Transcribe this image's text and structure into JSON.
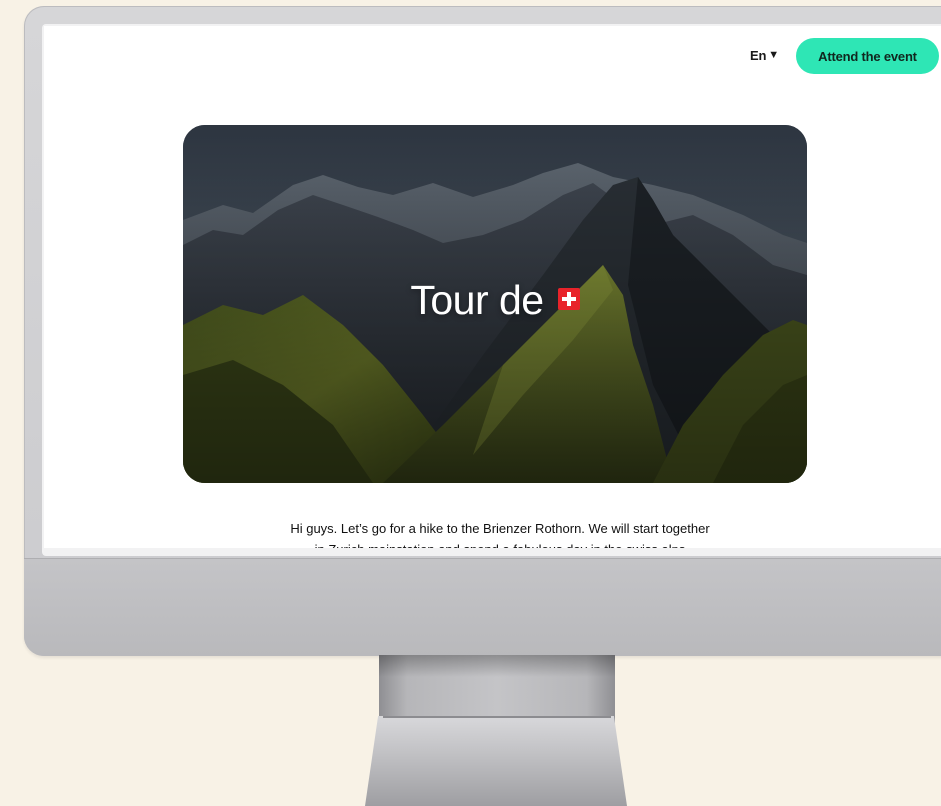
{
  "header": {
    "language": "En",
    "language_caret": "▼",
    "cta_label": "Attend the event"
  },
  "hero": {
    "title": "Tour de",
    "flag": "swiss-flag-icon"
  },
  "intro": {
    "line1": "Hi guys. Let’s go for a hike to the Brienzer Rothorn. We will start together",
    "line2": "in  Zurich mainstation and  spend a fabulous day in the swiss alps"
  },
  "colors": {
    "accent": "#2ee6b5",
    "background": "#f8f2e6",
    "flag_red": "#e8232a"
  }
}
